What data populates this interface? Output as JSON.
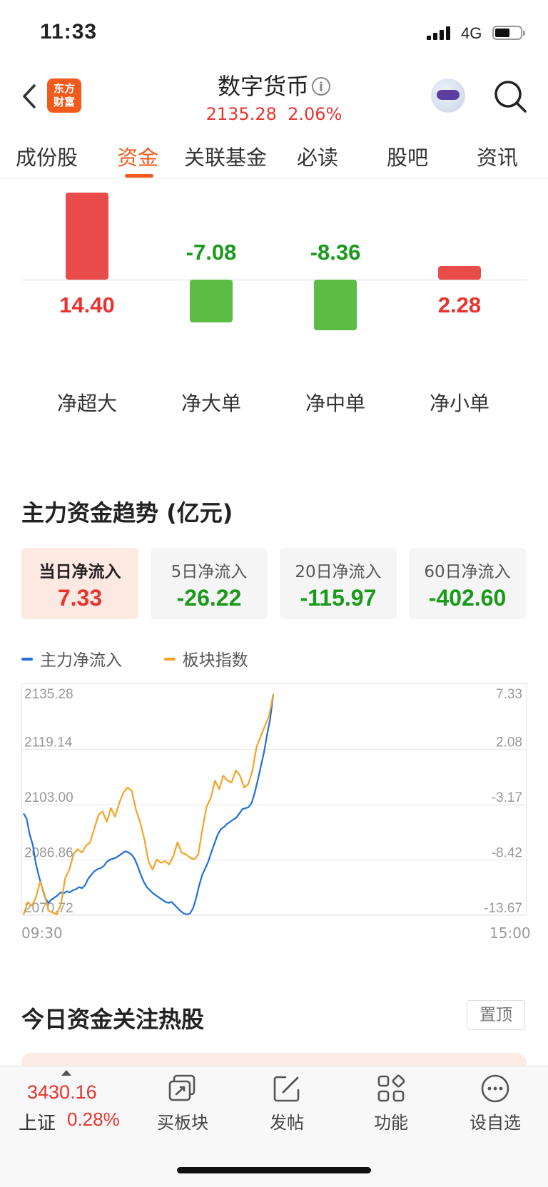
{
  "status": {
    "time": "11:33",
    "network": "4G"
  },
  "header": {
    "title": "数字货币",
    "info_icon": "info-icon",
    "index_value": "2135.28",
    "index_change": "2.06%",
    "logo_text": [
      "东方",
      "财富"
    ]
  },
  "tabs": [
    "成份股",
    "资金",
    "关联基金",
    "必读",
    "股吧",
    "资讯"
  ],
  "active_tab": "资金",
  "fund_flow": {
    "unit": "亿元",
    "items": [
      {
        "label": "净超大",
        "value": "14.40",
        "num": 14.4,
        "sign": "up"
      },
      {
        "label": "净大单",
        "value": "-7.08",
        "num": -7.08,
        "sign": "down"
      },
      {
        "label": "净中单",
        "value": "-8.36",
        "num": -8.36,
        "sign": "down"
      },
      {
        "label": "净小单",
        "value": "2.28",
        "num": 2.28,
        "sign": "up"
      }
    ]
  },
  "trend": {
    "title": "主力资金趋势 (亿元)",
    "cards": [
      {
        "label": "当日净流入",
        "value": "7.33",
        "active": true,
        "sign": "up"
      },
      {
        "label": "5日净流入",
        "value": "-26.22",
        "active": false,
        "sign": "down"
      },
      {
        "label": "20日净流入",
        "value": "-115.97",
        "active": false,
        "sign": "down"
      },
      {
        "label": "60日净流入",
        "value": "-402.60",
        "active": false,
        "sign": "down"
      }
    ],
    "legend": {
      "main": "主力净流入",
      "index": "板块指数"
    }
  },
  "chart_data": {
    "type": "line",
    "title": "",
    "x_start": "09:30",
    "x_end": "15:00",
    "left_axis": {
      "label": "板块指数",
      "ticks": [
        "2135.28",
        "2119.14",
        "2103.00",
        "2086.86",
        "2070.72"
      ],
      "ylim": [
        2070.72,
        2135.28
      ]
    },
    "right_axis": {
      "label": "主力净流入",
      "ticks": [
        "7.33",
        "2.08",
        "-3.17",
        "-8.42",
        "-13.67"
      ],
      "ylim": [
        -13.67,
        7.33
      ]
    },
    "grid": true,
    "series": [
      {
        "name": "主力净流入",
        "color": "#1f6fdc",
        "axis": "right",
        "values": [
          -4.0,
          -4.5,
          -6.0,
          -7.0,
          -8.8,
          -10.0,
          -11.0,
          -12.0,
          -12.5,
          -12.2,
          -12.0,
          -11.8,
          -11.5,
          -11.6,
          -11.4,
          -11.5,
          -11.3,
          -11.2,
          -11.0,
          -11.1,
          -10.8,
          -10.2,
          -9.8,
          -9.5,
          -9.3,
          -9.2,
          -9.0,
          -8.6,
          -8.4,
          -8.3,
          -8.2,
          -8.0,
          -7.8,
          -7.6,
          -7.7,
          -7.9,
          -8.3,
          -9.0,
          -9.8,
          -10.5,
          -11.0,
          -11.3,
          -11.6,
          -11.8,
          -12.0,
          -12.2,
          -12.4,
          -12.5,
          -12.4,
          -12.7,
          -13.0,
          -13.3,
          -13.5,
          -13.6,
          -13.5,
          -13.0,
          -12.0,
          -10.8,
          -9.8,
          -9.2,
          -8.5,
          -7.6,
          -6.8,
          -6.0,
          -5.5,
          -5.3,
          -5.0,
          -4.8,
          -4.6,
          -4.4,
          -4.0,
          -3.6,
          -3.5,
          -3.4,
          -3.0,
          -2.0,
          -0.8,
          0.5,
          1.8,
          3.5,
          5.0,
          7.33
        ]
      },
      {
        "name": "板块指数",
        "color": "#f3a425",
        "axis": "left",
        "values": [
          2070.9,
          2074.5,
          2073.5,
          2076.0,
          2080.5,
          2077.0,
          2072.0,
          2071.5,
          2071.0,
          2074.0,
          2081.5,
          2084.0,
          2088.5,
          2090.0,
          2089.0,
          2091.0,
          2092.0,
          2096.0,
          2100.0,
          2101.0,
          2098.0,
          2102.0,
          2099.5,
          2103.5,
          2106.5,
          2108.0,
          2107.0,
          2101.5,
          2098.0,
          2093.0,
          2086.5,
          2084.0,
          2087.0,
          2086.0,
          2086.5,
          2085.5,
          2088.0,
          2092.0,
          2089.0,
          2088.5,
          2087.5,
          2087.0,
          2088.5,
          2096.0,
          2102.5,
          2105.0,
          2110.0,
          2107.5,
          2111.5,
          2110.0,
          2109.5,
          2113.0,
          2111.5,
          2108.0,
          2109.0,
          2113.0,
          2120.0,
          2123.0,
          2126.0,
          2129.0,
          2135.28
        ]
      }
    ]
  },
  "hot_stocks": {
    "title": "今日资金关注热股",
    "pin_label": "置顶"
  },
  "bottom_bar": {
    "index_value": "3430.16",
    "index_name": "上证",
    "index_change": "0.28%",
    "items": [
      {
        "label": "买板块",
        "icon": "buy-sector-icon"
      },
      {
        "label": "发帖",
        "icon": "compose-icon"
      },
      {
        "label": "功能",
        "icon": "grid-icon"
      },
      {
        "label": "设自选",
        "icon": "more-dots-icon"
      }
    ]
  },
  "colors": {
    "accent": "#f25a1d",
    "up": "#e8342f",
    "down": "#1a9a1a",
    "bar_up": "#e94a4a",
    "bar_down": "#5bbd44"
  }
}
